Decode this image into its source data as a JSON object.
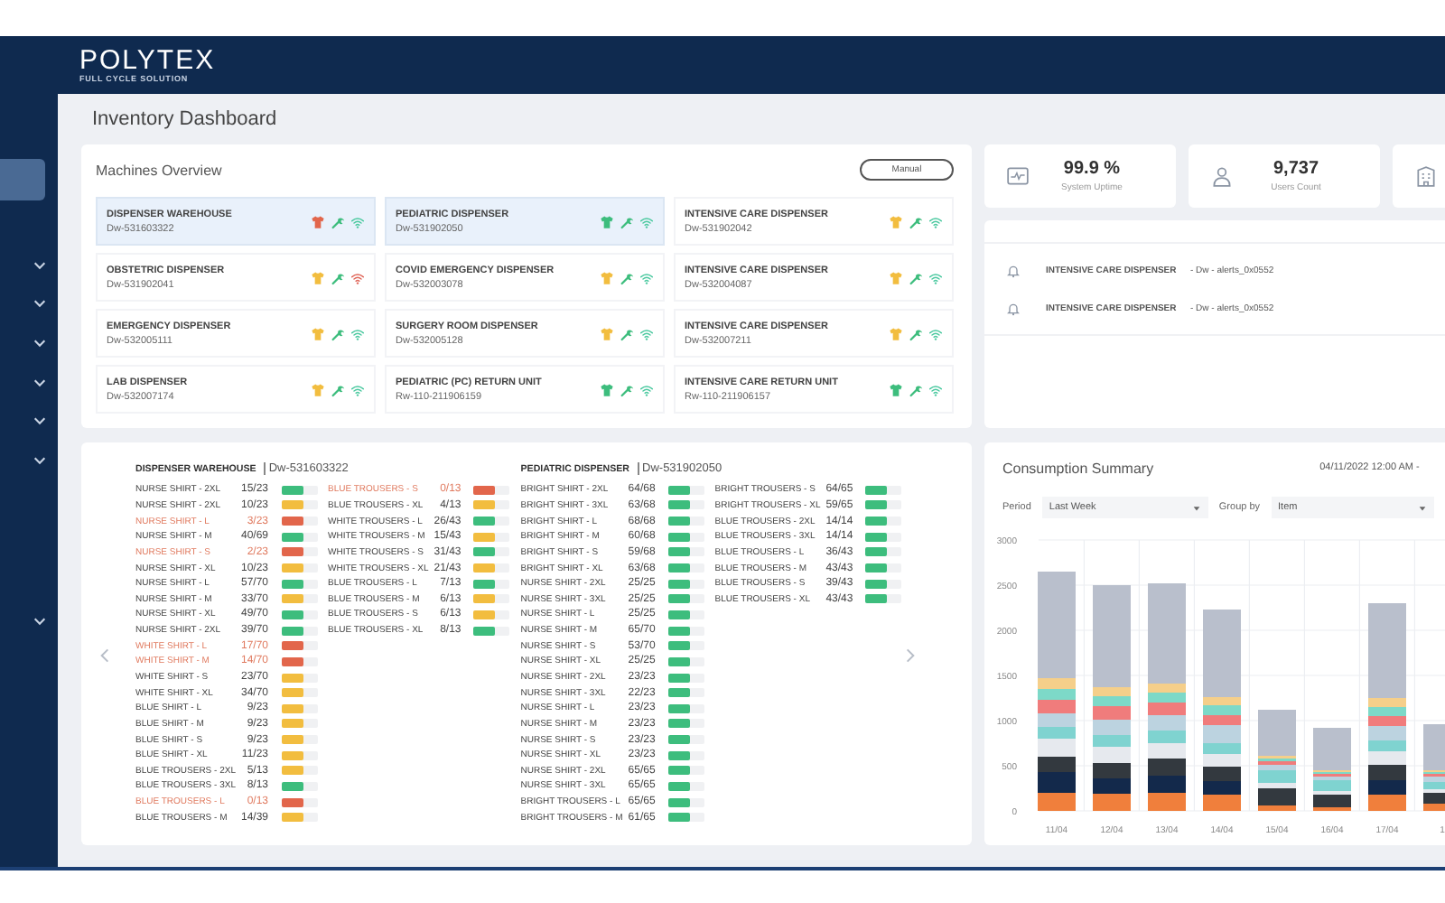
{
  "sidebar": {
    "items": [
      {
        "selected": true
      },
      {
        "selected": false
      },
      {
        "selected": false
      },
      {
        "selected": false
      },
      {
        "selected": false
      },
      {
        "selected": false
      },
      {
        "selected": false
      },
      {
        "selected": false
      }
    ]
  },
  "header": {
    "logo": "POLYTEX",
    "tagline": "FULL CYCLE SOLUTION"
  },
  "page_title": "Inventory Dashboard",
  "machines_overview": {
    "title": "Machines Overview",
    "manual_button": "Manual",
    "machines": [
      {
        "name": "DISPENSER WAREHOUSE",
        "code": "Dw-531603322",
        "selected": true,
        "color": "#e2664b",
        "online": true
      },
      {
        "name": "PEDIATRIC DISPENSER",
        "code": "Dw-531902050",
        "selected": true,
        "color": "#3dbd7d",
        "online": true
      },
      {
        "name": "INTENSIVE CARE DISPENSER",
        "code": "Dw-531902042",
        "selected": false,
        "color": "#f2bd3f",
        "online": true
      },
      {
        "name": "OBSTETRIC DISPENSER",
        "code": "Dw-531902041",
        "selected": false,
        "color": "#f2bd3f",
        "online": false
      },
      {
        "name": "COVID EMERGENCY DISPENSER",
        "code": "Dw-532003078",
        "selected": false,
        "color": "#f2bd3f",
        "online": true
      },
      {
        "name": "INTENSIVE CARE DISPENSER",
        "code": "Dw-532004087",
        "selected": false,
        "color": "#f2bd3f",
        "online": true
      },
      {
        "name": "EMERGENCY DISPENSER",
        "code": "Dw-532005111",
        "selected": false,
        "color": "#f2bd3f",
        "online": true
      },
      {
        "name": "SURGERY ROOM DISPENSER",
        "code": "Dw-532005128",
        "selected": false,
        "color": "#f2bd3f",
        "online": true
      },
      {
        "name": "INTENSIVE CARE DISPENSER",
        "code": "Dw-532007211",
        "selected": false,
        "color": "#f2bd3f",
        "online": true
      },
      {
        "name": "LAB DISPENSER",
        "code": "Dw-532007174",
        "selected": false,
        "color": "#f2bd3f",
        "online": true
      },
      {
        "name": "PEDIATRIC (PC) RETURN UNIT",
        "code": "Rw-110-211906159",
        "selected": false,
        "color": "#3dbd7d",
        "online": true
      },
      {
        "name": "INTENSIVE CARE RETURN UNIT",
        "code": "Rw-110-211906157",
        "selected": false,
        "color": "#3dbd7d",
        "online": true
      }
    ]
  },
  "stats": [
    {
      "kind": "uptime",
      "value": "99.9 %",
      "label": "System Uptime"
    },
    {
      "kind": "users",
      "value": "9,737",
      "label": "Users Count"
    },
    {
      "kind": "building"
    }
  ],
  "alerts": [
    {
      "machine": "INTENSIVE CARE DISPENSER",
      "detail": "- Dw - alerts_0x0552"
    },
    {
      "machine": "INTENSIVE CARE DISPENSER",
      "detail": "- Dw - alerts_0x0552"
    }
  ],
  "inventory": {
    "tables": [
      {
        "machine": "DISPENSER WAREHOUSE",
        "code": "Dw-531603322",
        "columns": [
          [
            {
              "item": "NURSE SHIRT - 2XL",
              "count": "15/23",
              "color": "#3dbd7d",
              "low": false
            },
            {
              "item": "NURSE SHIRT - 2XL",
              "count": "10/23",
              "color": "#f2bd3f",
              "low": false
            },
            {
              "item": "NURSE SHIRT - L",
              "count": "3/23",
              "color": "#e2664b",
              "low": true
            },
            {
              "item": "NURSE SHIRT - M",
              "count": "40/69",
              "color": "#3dbd7d",
              "low": false
            },
            {
              "item": "NURSE SHIRT - S",
              "count": "2/23",
              "color": "#e2664b",
              "low": true
            },
            {
              "item": "NURSE SHIRT - XL",
              "count": "10/23",
              "color": "#f2bd3f",
              "low": false
            },
            {
              "item": "NURSE SHIRT - L",
              "count": "57/70",
              "color": "#3dbd7d",
              "low": false
            },
            {
              "item": "NURSE SHIRT - M",
              "count": "33/70",
              "color": "#f2bd3f",
              "low": false
            },
            {
              "item": "NURSE SHIRT - XL",
              "count": "49/70",
              "color": "#3dbd7d",
              "low": false
            },
            {
              "item": "NURSE SHIRT - 2XL",
              "count": "39/70",
              "color": "#3dbd7d",
              "low": false
            },
            {
              "item": "WHITE SHIRT - L",
              "count": "17/70",
              "color": "#e2664b",
              "low": true
            },
            {
              "item": "WHITE SHIRT - M",
              "count": "14/70",
              "color": "#e2664b",
              "low": true
            },
            {
              "item": "WHITE SHIRT - S",
              "count": "23/70",
              "color": "#f2bd3f",
              "low": false
            },
            {
              "item": "WHITE SHIRT - XL",
              "count": "34/70",
              "color": "#f2bd3f",
              "low": false
            },
            {
              "item": "BLUE SHIRT - L",
              "count": "9/23",
              "color": "#f2bd3f",
              "low": false
            },
            {
              "item": "BLUE SHIRT - M",
              "count": "9/23",
              "color": "#f2bd3f",
              "low": false
            },
            {
              "item": "BLUE SHIRT - S",
              "count": "9/23",
              "color": "#f2bd3f",
              "low": false
            },
            {
              "item": "BLUE SHIRT - XL",
              "count": "11/23",
              "color": "#f2bd3f",
              "low": false
            },
            {
              "item": "BLUE TROUSERS - 2XL",
              "count": "5/13",
              "color": "#f2bd3f",
              "low": false
            },
            {
              "item": "BLUE TROUSERS - 3XL",
              "count": "8/13",
              "color": "#3dbd7d",
              "low": false
            },
            {
              "item": "BLUE TROUSERS - L",
              "count": "0/13",
              "color": "#e2664b",
              "low": true
            },
            {
              "item": "BLUE TROUSERS - M",
              "count": "14/39",
              "color": "#f2bd3f",
              "low": false
            }
          ],
          [
            {
              "item": "BLUE TROUSERS - S",
              "count": "0/13",
              "color": "#e2664b",
              "low": true
            },
            {
              "item": "BLUE TROUSERS - XL",
              "count": "4/13",
              "color": "#f2bd3f",
              "low": false
            },
            {
              "item": "WHITE TROUSERS - L",
              "count": "26/43",
              "color": "#3dbd7d",
              "low": false
            },
            {
              "item": "WHITE TROUSERS - M",
              "count": "15/43",
              "color": "#f2bd3f",
              "low": false
            },
            {
              "item": "WHITE TROUSERS - S",
              "count": "31/43",
              "color": "#3dbd7d",
              "low": false
            },
            {
              "item": "WHITE TROUSERS - XL",
              "count": "21/43",
              "color": "#f2bd3f",
              "low": false
            },
            {
              "item": "BLUE TROUSERS - L",
              "count": "7/13",
              "color": "#3dbd7d",
              "low": false
            },
            {
              "item": "BLUE TROUSERS - M",
              "count": "6/13",
              "color": "#f2bd3f",
              "low": false
            },
            {
              "item": "BLUE TROUSERS - S",
              "count": "6/13",
              "color": "#f2bd3f",
              "low": false
            },
            {
              "item": "BLUE TROUSERS - XL",
              "count": "8/13",
              "color": "#3dbd7d",
              "low": false
            }
          ]
        ]
      },
      {
        "machine": "PEDIATRIC DISPENSER",
        "code": "Dw-531902050",
        "columns": [
          [
            {
              "item": "BRIGHT SHIRT - 2XL",
              "count": "64/68",
              "color": "#3dbd7d",
              "low": false
            },
            {
              "item": "BRIGHT SHIRT - 3XL",
              "count": "63/68",
              "color": "#3dbd7d",
              "low": false
            },
            {
              "item": "BRIGHT SHIRT - L",
              "count": "68/68",
              "color": "#3dbd7d",
              "low": false
            },
            {
              "item": "BRIGHT SHIRT - M",
              "count": "60/68",
              "color": "#3dbd7d",
              "low": false
            },
            {
              "item": "BRIGHT SHIRT - S",
              "count": "59/68",
              "color": "#3dbd7d",
              "low": false
            },
            {
              "item": "BRIGHT SHIRT - XL",
              "count": "63/68",
              "color": "#3dbd7d",
              "low": false
            },
            {
              "item": "NURSE SHIRT - 2XL",
              "count": "25/25",
              "color": "#3dbd7d",
              "low": false
            },
            {
              "item": "NURSE SHIRT - 3XL",
              "count": "25/25",
              "color": "#3dbd7d",
              "low": false
            },
            {
              "item": "NURSE SHIRT - L",
              "count": "25/25",
              "color": "#3dbd7d",
              "low": false
            },
            {
              "item": "NURSE SHIRT - M",
              "count": "65/70",
              "color": "#3dbd7d",
              "low": false
            },
            {
              "item": "NURSE SHIRT - S",
              "count": "53/70",
              "color": "#3dbd7d",
              "low": false
            },
            {
              "item": "NURSE SHIRT - XL",
              "count": "25/25",
              "color": "#3dbd7d",
              "low": false
            },
            {
              "item": "NURSE SHIRT - 2XL",
              "count": "23/23",
              "color": "#3dbd7d",
              "low": false
            },
            {
              "item": "NURSE SHIRT - 3XL",
              "count": "22/23",
              "color": "#3dbd7d",
              "low": false
            },
            {
              "item": "NURSE SHIRT - L",
              "count": "23/23",
              "color": "#3dbd7d",
              "low": false
            },
            {
              "item": "NURSE SHIRT - M",
              "count": "23/23",
              "color": "#3dbd7d",
              "low": false
            },
            {
              "item": "NURSE SHIRT - S",
              "count": "23/23",
              "color": "#3dbd7d",
              "low": false
            },
            {
              "item": "NURSE SHIRT - XL",
              "count": "23/23",
              "color": "#3dbd7d",
              "low": false
            },
            {
              "item": "NURSE SHIRT - 2XL",
              "count": "65/65",
              "color": "#3dbd7d",
              "low": false
            },
            {
              "item": "NURSE SHIRT - 3XL",
              "count": "65/65",
              "color": "#3dbd7d",
              "low": false
            },
            {
              "item": "BRIGHT TROUSERS - L",
              "count": "65/65",
              "color": "#3dbd7d",
              "low": false
            },
            {
              "item": "BRIGHT TROUSERS - M",
              "count": "61/65",
              "color": "#3dbd7d",
              "low": false
            }
          ],
          [
            {
              "item": "BRIGHT TROUSERS - S",
              "count": "64/65",
              "color": "#3dbd7d",
              "low": false
            },
            {
              "item": "BRIGHT TROUSERS - XL",
              "count": "59/65",
              "color": "#3dbd7d",
              "low": false
            },
            {
              "item": "BLUE TROUSERS - 2XL",
              "count": "14/14",
              "color": "#3dbd7d",
              "low": false
            },
            {
              "item": "BLUE TROUSERS - 3XL",
              "count": "14/14",
              "color": "#3dbd7d",
              "low": false
            },
            {
              "item": "BLUE TROUSERS - L",
              "count": "36/43",
              "color": "#3dbd7d",
              "low": false
            },
            {
              "item": "BLUE TROUSERS - M",
              "count": "43/43",
              "color": "#3dbd7d",
              "low": false
            },
            {
              "item": "BLUE TROUSERS - S",
              "count": "39/43",
              "color": "#3dbd7d",
              "low": false
            },
            {
              "item": "BLUE TROUSERS - XL",
              "count": "43/43",
              "color": "#3dbd7d",
              "low": false
            }
          ]
        ]
      }
    ]
  },
  "consumption": {
    "title": "Consumption Summary",
    "date_range": "04/11/2022 12:00 AM -",
    "period_label": "Period",
    "period": "Last Week",
    "group_label": "Group by",
    "group": "Item",
    "chart_data": {
      "type": "bar",
      "stacked": true,
      "grid": true,
      "categories": [
        "11/04",
        "12/04",
        "13/04",
        "14/04",
        "15/04",
        "16/04",
        "17/04",
        "1"
      ],
      "ylim": [
        0,
        3000
      ],
      "yticks": [
        0,
        500,
        1000,
        1500,
        2000,
        2500,
        3000
      ],
      "series": [
        {
          "color": "#f07f3c",
          "values": [
            200,
            190,
            200,
            180,
            60,
            40,
            180,
            80
          ]
        },
        {
          "color": "#13294b",
          "values": [
            230,
            170,
            190,
            150,
            0,
            0,
            160,
            0
          ]
        },
        {
          "color": "#33393f",
          "values": [
            170,
            170,
            190,
            160,
            190,
            140,
            170,
            120
          ]
        },
        {
          "color": "#e6e9ee",
          "values": [
            200,
            180,
            170,
            140,
            60,
            40,
            150,
            40
          ]
        },
        {
          "color": "#7fd3d0",
          "values": [
            130,
            130,
            140,
            120,
            140,
            120,
            120,
            80
          ]
        },
        {
          "color": "#bcd3e0",
          "values": [
            150,
            170,
            170,
            200,
            60,
            40,
            160,
            60
          ]
        },
        {
          "color": "#f07c7c",
          "values": [
            150,
            150,
            140,
            110,
            40,
            30,
            110,
            30
          ]
        },
        {
          "color": "#7dd9c8",
          "values": [
            120,
            110,
            110,
            110,
            30,
            20,
            100,
            20
          ]
        },
        {
          "color": "#f5cf8a",
          "values": [
            120,
            100,
            100,
            90,
            30,
            20,
            100,
            20
          ]
        },
        {
          "color": "#b9bfcc",
          "values": [
            1180,
            1130,
            1110,
            970,
            510,
            470,
            1050,
            510
          ]
        }
      ]
    }
  }
}
